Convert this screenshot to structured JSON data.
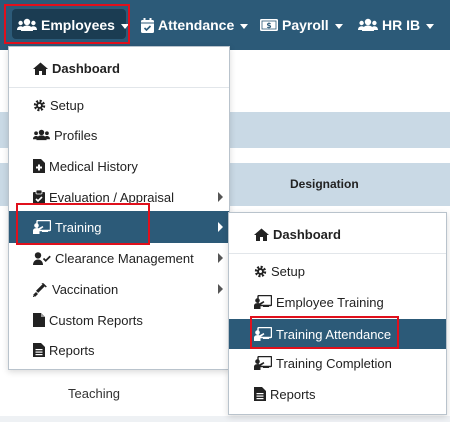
{
  "navbar": {
    "items": [
      {
        "label": "Employees",
        "icon": "users-icon"
      },
      {
        "label": "Attendance",
        "icon": "calendar-check-icon"
      },
      {
        "label": "Payroll",
        "icon": "money-bill-icon"
      },
      {
        "label": "HR IB",
        "icon": "users-icon"
      }
    ]
  },
  "page": {
    "designation_header": "Designation",
    "row_teaching": "Teaching"
  },
  "employees_menu": {
    "items": [
      {
        "label": "Dashboard",
        "icon": "home-icon"
      },
      {
        "label": "Setup",
        "icon": "gear-icon"
      },
      {
        "label": "Profiles",
        "icon": "users-icon"
      },
      {
        "label": "Medical History",
        "icon": "medical-file-icon"
      },
      {
        "label": "Evaluation / Appraisal",
        "icon": "clipboard-check-icon"
      },
      {
        "label": "Training",
        "icon": "chalkboard-teacher-icon"
      },
      {
        "label": "Clearance Management",
        "icon": "user-check-icon"
      },
      {
        "label": "Vaccination",
        "icon": "syringe-icon"
      },
      {
        "label": "Custom Reports",
        "icon": "file-icon"
      },
      {
        "label": "Reports",
        "icon": "file-text-icon"
      }
    ]
  },
  "training_menu": {
    "items": [
      {
        "label": "Dashboard",
        "icon": "home-icon"
      },
      {
        "label": "Setup",
        "icon": "gear-icon"
      },
      {
        "label": "Employee Training",
        "icon": "chalkboard-teacher-icon"
      },
      {
        "label": "Training Attendance",
        "icon": "chalkboard-teacher-icon"
      },
      {
        "label": "Training Completion",
        "icon": "chalkboard-teacher-icon"
      },
      {
        "label": "Reports",
        "icon": "file-text-icon"
      }
    ]
  },
  "colors": {
    "navbar": "#2c5a78",
    "active_item": "#2c5a78",
    "highlight_box": "#e0101c",
    "table_band": "#c9d9e5"
  }
}
